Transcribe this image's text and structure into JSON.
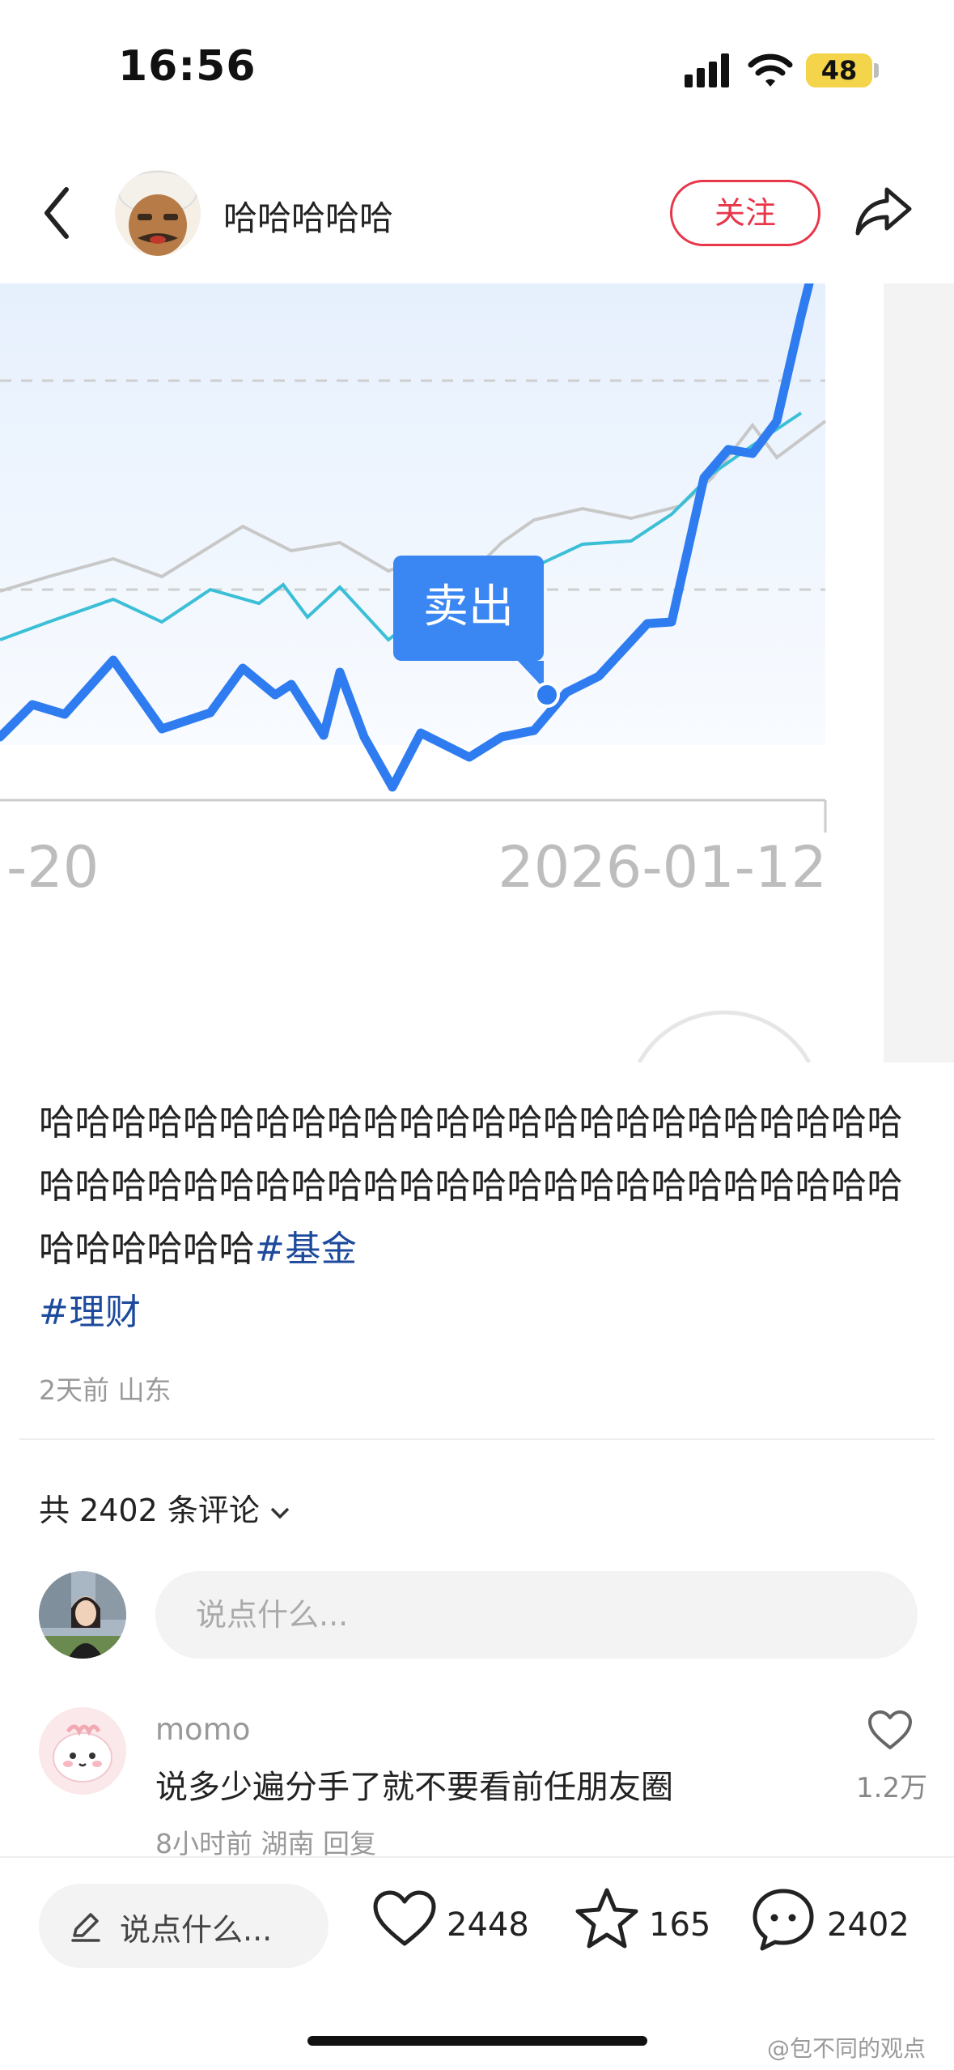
{
  "status_bar": {
    "time": "16:56",
    "battery": "48"
  },
  "header": {
    "author_name": "哈哈哈哈哈",
    "follow_label": "关注"
  },
  "chart_data": {
    "type": "line",
    "x_tick_labels": [
      "-20",
      "2026-01-12"
    ],
    "annotation": "卖出",
    "series": [
      {
        "color": "#2f7cf0"
      },
      {
        "color": "#3bbfd6"
      },
      {
        "color": "#c8c8c8"
      }
    ]
  },
  "post": {
    "body": "哈哈哈哈哈哈哈哈哈哈哈哈哈哈哈哈哈哈哈哈哈哈哈哈哈哈哈哈哈哈哈哈哈哈哈哈哈哈哈哈哈哈哈哈哈哈哈哈哈哈哈哈哈哈",
    "tags": [
      "#基金",
      "#理财"
    ],
    "time_ago": "2天前",
    "location": "山东"
  },
  "comments": {
    "count_label": "共 2402 条评论",
    "input_placeholder": "说点什么...",
    "items": [
      {
        "user": "momo",
        "text": "说多少遍分手了就不要看前任朋友圈",
        "time_ago": "8小时前",
        "location": "湖南",
        "reply_label": "回复",
        "likes": "1.2万"
      }
    ]
  },
  "bottom_bar": {
    "input_placeholder": "说点什么...",
    "likes": "2448",
    "stars": "165",
    "comments": "2402"
  },
  "watermark": "@包不同的观点",
  "colors": {
    "accent": "#e8364a",
    "tag": "#1d4a9c",
    "chart_main": "#2f7cf0"
  }
}
